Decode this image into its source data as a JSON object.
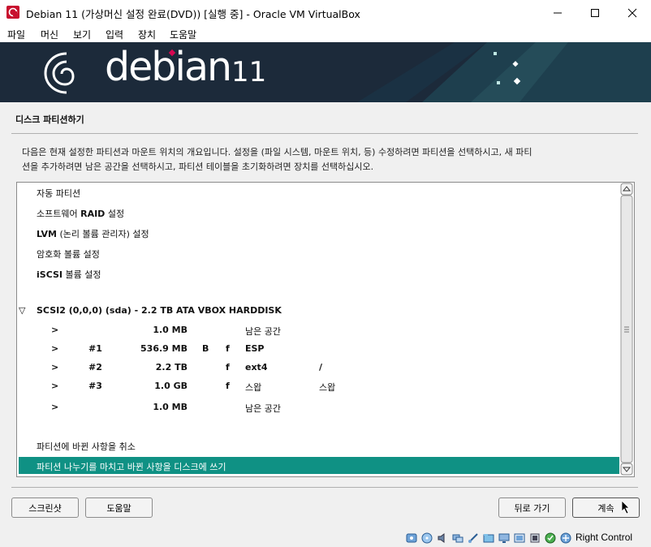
{
  "window": {
    "title": "Debian 11 (가상머신 설정 완료(DVD)) [실행 중] - Oracle VM VirtualBox",
    "menu": [
      "파일",
      "머신",
      "보기",
      "입력",
      "장치",
      "도움말"
    ]
  },
  "banner": {
    "logo": "debian",
    "version": "11"
  },
  "installer": {
    "step_title": "디스크 파티션하기",
    "description_line1": "다음은 현재 설정한 파티션과 마운트 위치의 개요입니다. 설정을 (파일 시스템, 마운트 위치, 등) 수정하려면 파티션을 선택하시고, 새 파티",
    "description_line2": "션을 추가하려면 남은 공간을 선택하시고, 파티션 테이블을 초기화하려면 장치를 선택하십시오.",
    "options": {
      "auto": "자동 파티션",
      "raid_pre": "소프트웨어 ",
      "raid_bold": "RAID",
      "raid_post": " 설정",
      "lvm_bold": "LVM",
      "lvm_post": " (논리 볼륨 관리자) 설정",
      "encrypt": "암호화 볼륨 설정",
      "iscsi_bold": "iSCSI",
      "iscsi_post": " 볼륨 설정"
    },
    "disk": {
      "toggle": "▽",
      "label": "SCSI2 (0,0,0) (sda) - 2.2 TB ATA VBOX HARDDISK"
    },
    "partitions": [
      {
        "arrow": ">",
        "num": "",
        "size": "1.0 MB",
        "flag1": "",
        "flag2": "",
        "fs": "남은 공간",
        "mount": ""
      },
      {
        "arrow": ">",
        "num": "#1",
        "size": "536.9 MB",
        "flag1": "B",
        "flag2": "f",
        "fs": "ESP",
        "mount": ""
      },
      {
        "arrow": ">",
        "num": "#2",
        "size": "2.2 TB",
        "flag1": "",
        "flag2": "f",
        "fs": "ext4",
        "mount": "/"
      },
      {
        "arrow": ">",
        "num": "#3",
        "size": "1.0 GB",
        "flag1": "",
        "flag2": "f",
        "fs": "스왑",
        "mount": "스왑"
      },
      {
        "arrow": ">",
        "num": "",
        "size": "1.0 MB",
        "flag1": "",
        "flag2": "",
        "fs": "남은 공간",
        "mount": ""
      }
    ],
    "undo": "파티션에 바뀐 사항을 취소",
    "finish": "파티션 나누기를 마치고 바뀐 사항을 디스크에 쓰기"
  },
  "buttons": {
    "screenshot": "스크린샷",
    "help": "도움말",
    "back": "뒤로 가기",
    "continue": "계속"
  },
  "statusbar": {
    "host_key": "Right Control"
  },
  "colors": {
    "selection": "#0f9184",
    "banner": "#1c2a3a",
    "accent_red": "#d70751"
  }
}
